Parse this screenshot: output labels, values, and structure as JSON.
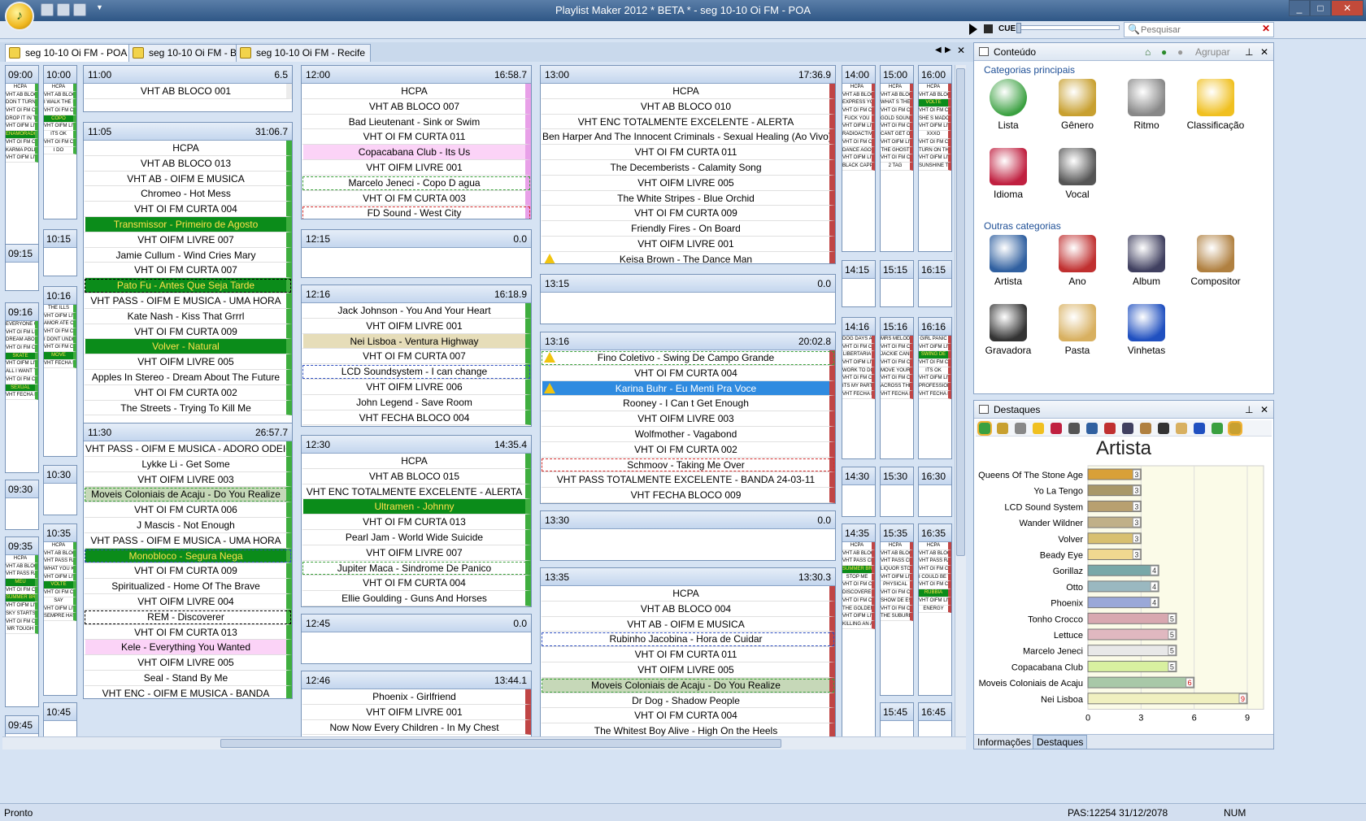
{
  "window": {
    "title": "Playlist Maker 2012 * BETA * - seg 10-10 Oi FM - POA"
  },
  "toolbar": {
    "cue": "CUE",
    "search_placeholder": "Pesquisar"
  },
  "tabs": [
    "seg 10-10 Oi FM - POA",
    "seg 10-10 Oi FM - BH",
    "seg 10-10 Oi FM - Recife"
  ],
  "blocks": {
    "b1100": {
      "time": "11:00",
      "dur": "6.5",
      "items": [
        "VHT AB BLOCO 001"
      ]
    },
    "b1105": {
      "time": "11:05",
      "dur": "31:06.7",
      "items": [
        "HCPA",
        "VHT AB BLOCO 013",
        "VHT AB - OIFM E MUSICA",
        "Chromeo - Hot Mess",
        "VHT OI FM CURTA 004",
        "Transmissor - Primeiro de Agosto",
        "VHT OIFM LIVRE 007",
        "Jamie Cullum - Wind Cries Mary",
        "VHT OI FM CURTA 007",
        "Pato Fu - Antes Que Seja Tarde",
        "VHT PASS - OIFM E MUSICA - UMA HORA",
        "Kate Nash - Kiss That Grrrl",
        "VHT OI FM CURTA 009",
        "Volver - Natural",
        "VHT OIFM LIVRE 005",
        "Apples In Stereo - Dream About The Future",
        "VHT OI FM CURTA 002",
        "The Streets - Trying To Kill Me"
      ]
    },
    "b1130": {
      "time": "11:30",
      "dur": "26:57.7",
      "items": [
        "VHT PASS - OIFM E MUSICA - ADORO ODEIO",
        "Lykke Li - Get Some",
        "VHT OIFM LIVRE 003",
        "Moveis Coloniais de Acaju - Do You Realize",
        "VHT OI FM CURTA 006",
        "J Mascis - Not Enough",
        "VHT PASS - OIFM E MUSICA - UMA HORA",
        "Monobloco - Segura Nega",
        "VHT OI FM CURTA 009",
        "Spiritualized - Home Of The Brave",
        "VHT OIFM LIVRE 004",
        "REM - Discoverer",
        "VHT OI FM CURTA 013",
        "Kele - Everything You Wanted",
        "VHT OIFM LIVRE 005",
        "Seal - Stand By Me",
        "VHT ENC - OIFM E MUSICA - BANDA"
      ]
    },
    "b1200": {
      "time": "12:00",
      "dur": "16:58.7",
      "items": [
        "HCPA",
        "VHT AB BLOCO 007",
        "Bad Lieutenant - Sink or Swim",
        "VHT OI FM CURTA 011",
        "Copacabana Club - Its Us",
        "VHT OIFM LIVRE 001",
        "Marcelo Jeneci - Copo D agua",
        "VHT OI FM CURTA 003",
        "FD Sound - West City"
      ]
    },
    "b1215": {
      "time": "12:15",
      "dur": "0.0",
      "items": []
    },
    "b1216": {
      "time": "12:16",
      "dur": "16:18.9",
      "items": [
        "Jack Johnson - You And Your Heart",
        "VHT OIFM LIVRE 001",
        "Nei Lisboa - Ventura Highway",
        "VHT OI FM CURTA 007",
        "LCD Soundsystem - I can change",
        "VHT OIFM LIVRE 006",
        "John Legend - Save Room",
        "VHT FECHA BLOCO 004"
      ]
    },
    "b1230": {
      "time": "12:30",
      "dur": "14:35.4",
      "items": [
        "HCPA",
        "VHT AB BLOCO 015",
        "VHT ENC TOTALMENTE EXCELENTE - ALERTA",
        "Ultramen - Johnny",
        "VHT OI FM CURTA 013",
        "Pearl Jam - World Wide Suicide",
        "VHT OIFM LIVRE 007",
        "Jupiter Maca - Sindrome De Panico",
        "VHT OI FM CURTA 004",
        "Ellie Goulding - Guns And Horses"
      ]
    },
    "b1245": {
      "time": "12:45",
      "dur": "0.0",
      "items": []
    },
    "b1246": {
      "time": "12:46",
      "dur": "13:44.1",
      "items": [
        "Phoenix - Girlfriend",
        "VHT OIFM LIVRE 001",
        "Now Now Every Children - In My Chest"
      ]
    },
    "b1300": {
      "time": "13:00",
      "dur": "17:36.9",
      "items": [
        "HCPA",
        "VHT AB BLOCO 010",
        "VHT ENC TOTALMENTE EXCELENTE - ALERTA",
        "Ben Harper And The Innocent Criminals - Sexual Healing (Ao Vivo)",
        "VHT OI FM CURTA 011",
        "The Decemberists - Calamity Song",
        "VHT OIFM LIVRE 005",
        "The White Stripes - Blue Orchid",
        "VHT OI FM CURTA 009",
        "Friendly Fires -  On Board",
        "VHT OIFM LIVRE 001",
        "Keisa Brown - The Dance Man"
      ]
    },
    "b1315": {
      "time": "13:15",
      "dur": "0.0",
      "items": []
    },
    "b1316": {
      "time": "13:16",
      "dur": "20:02.8",
      "items": [
        "Fino Coletivo - Swing De Campo Grande",
        "VHT OI FM CURTA 004",
        "Karina Buhr - Eu Menti Pra Voce",
        "Rooney - I Can t Get Enough",
        "VHT OIFM LIVRE 003",
        "Wolfmother - Vagabond",
        "VHT OI FM CURTA 002",
        "Schmoov - Taking Me Over",
        "VHT PASS TOTALMENTE EXCELENTE - BANDA 24-03-11",
        "VHT FECHA BLOCO 009"
      ]
    },
    "b1330": {
      "time": "13:30",
      "dur": "0.0",
      "items": []
    },
    "b1335": {
      "time": "13:35",
      "dur": "13:30.3",
      "items": [
        "HCPA",
        "VHT AB BLOCO 004",
        "VHT AB - OIFM E MUSICA",
        "Rubinho Jacobina - Hora de Cuidar",
        "VHT OI FM CURTA 011",
        "VHT OIFM LIVRE 005",
        "Moveis Coloniais de Acaju - Do You Realize",
        "Dr Dog - Shadow People",
        "VHT OI FM CURTA 004",
        "The Whitest Boy Alive - High On the Heels"
      ]
    }
  },
  "mini": {
    "c0900": {
      "time": "09:00",
      "items": [
        "HCPA",
        "VHT AB BLOCO 016",
        "DON T TURN AROUND",
        "VHT OI FM CURTA 013",
        "DROP IT IN THE SLOT",
        "VHT OIFM LIVRE 006",
        "ENAMORADO",
        "VHT OI FM CURTA 002",
        "KARMA POLICE",
        "VHT OIFM LIVRE 003"
      ]
    },
    "c0915": {
      "time": "09:15",
      "items": []
    },
    "c0916": {
      "time": "09:16",
      "items": [
        "EVERYONE GETS A STAR",
        "VHT OI FM LIVRE 003",
        "DREAM ABOUT THE",
        "VHT OI FM CURTA 009",
        "SKATE",
        "VHT OIFM LIVRE 006",
        "ALL I WANT TO DO",
        "VHT OI FM CURTA 005",
        "SEXUAL",
        "VHT FECHA BLOCO 007"
      ]
    },
    "c0930": {
      "time": "09:30",
      "items": []
    },
    "c0935": {
      "time": "09:35",
      "items": [
        "HCPA",
        "VHT AB BLOCO 003",
        "VHT PASS RADIO CAFE",
        "MEU",
        "VHT OI FM CURTA 011",
        "SUMMER BREEZE",
        "VHT OIFM LIVRE 001",
        "SKY STARTS FALLING",
        "VHT OI FM CURTA 002",
        "MR TOUGH"
      ]
    },
    "c0945": {
      "time": "09:45",
      "items": []
    },
    "c1000": {
      "time": "10:00",
      "items": [
        "HCPA",
        "VHT AB BLOCO 002",
        "I WALK THE LINE",
        "VHT OI FM CURTA 005",
        "COPO",
        "VHT OIFM LIVRE 001",
        "ITS OK",
        "VHT OI FM CURTA 004",
        "I DO"
      ]
    },
    "c1015": {
      "time": "10:15",
      "items": []
    },
    "c1016": {
      "time": "10:16",
      "items": [
        "THE ILLS",
        "VHT OIFM LIVRE 007",
        "AMOR ATE O FIM",
        "VHT OI FM CURTA 003",
        "I DONT UNDERSTAND",
        "VHT OI FM CURTA 006",
        "MOVE",
        "VHT FECHA BLOCO 001"
      ]
    },
    "c1030": {
      "time": "10:30",
      "items": []
    },
    "c1035": {
      "time": "10:35",
      "items": [
        "HCPA",
        "VHT AB BLOCO 016",
        "VHT PASS RADIO CAFE",
        "WHAT YOU KNOW",
        "VHT OIFM LIVRE 005",
        "VOLTE",
        "VHT OI FM CURTA 004",
        "SAY",
        "VHT OIFM LIVRE 007",
        "SEMPRE HAY ESPERANZA"
      ]
    },
    "c1045": {
      "time": "10:45",
      "items": []
    },
    "c1400": {
      "time": "14:00",
      "items": [
        "HCPA",
        "VHT AB BLOCO 004",
        "EXPRESS YOURSELF",
        "VHT OI FM CURTA 009",
        "FUCK YOU",
        "VHT OIFM LIVRE 001",
        "RADIOACTIVE",
        "VHT OI FM CURTA 011",
        "DANCE AGORA",
        "VHT OIFM LIVRE 004",
        "BLACK CAPPUCCINO"
      ]
    },
    "c1415": {
      "time": "14:15",
      "items": []
    },
    "c1416": {
      "time": "14:16",
      "items": [
        "DOG DAYS ARE OVER",
        "VHT OI FM CURTA 009",
        "LIBERTARIA",
        "VHT OIFM LIVRE 002",
        "WORK TO DO",
        "VHT OI FM CURTA 004",
        "ITS MY PARTY",
        "VHT FECHA BLOCO 008"
      ]
    },
    "c1430": {
      "time": "14:30",
      "items": []
    },
    "c1435": {
      "time": "14:35",
      "items": [
        "HCPA",
        "VHT AB BLOCO 013",
        "VHT PASS CLUBE OIFM",
        "SUMMER BREEZE",
        "STOP ME",
        "VHT OI FM CURTA 003",
        "DISCOVERER",
        "VHT OI FM CURTA 006",
        "THE GOLDEN AGE",
        "VHT OIFM LIVRE 001",
        "KILLING AN ARAB"
      ]
    },
    "c1500": {
      "time": "15:00",
      "items": [
        "HCPA",
        "VHT AB BLOCO 015",
        "WHAT S THE COST",
        "VHT OI FM CURTA 009",
        "GOLD SOUNDZ",
        "VHT OI FM CURTA 011",
        "CANT GET OVER YOU",
        "VHT OIFM LIVRE 003",
        "THE GHOST",
        "VHT OI FM CURTA 009",
        "2 TAG"
      ]
    },
    "c1515": {
      "time": "15:15",
      "items": []
    },
    "c1516": {
      "time": "15:16",
      "items": [
        "MRS MELODY",
        "VHT OI FM CURTA 009",
        "JACKIE CANE",
        "VHT OI FM CURTA 006",
        "MOVE YOUR FEET",
        "VHT OI FM CURTA 003",
        "ACROSS THE UNIVERSE",
        "VHT FECHA BLOCO 005"
      ]
    },
    "c1530": {
      "time": "15:30",
      "items": []
    },
    "c1535": {
      "time": "15:35",
      "items": [
        "HCPA",
        "VHT AB BLOCO 014",
        "VHT PASS CLUBE OIFM",
        "LIQUOR STORE BLUES",
        "VHT OIFM LIVRE 001",
        "PHYSICAL",
        "VHT OI FM CURTA 004",
        "SHOW DE ESTRELAS",
        "VHT OI FM CURTA 002",
        "THE SUBURBS"
      ]
    },
    "c1545": {
      "time": "15:45",
      "items": []
    },
    "c1600": {
      "time": "16:00",
      "items": [
        "HCPA",
        "VHT AB BLOCO 010",
        "VOLTE",
        "VHT OI FM CURTA 013",
        "SHE S MADONNA",
        "VHT OIFM LIVRE 006",
        "XXXO",
        "VHT OI FM CURTA 006",
        "TURN ON THE SCREW",
        "VHT OIFM LIVRE 006",
        "SUNSHINE TODAY"
      ]
    },
    "c1615": {
      "time": "16:15",
      "items": []
    },
    "c1616": {
      "time": "16:16",
      "items": [
        "GIRL PANIC",
        "VHT OIFM LIVRE 003",
        "SWING DE",
        "VHT OI FM CURTA 008",
        "ITS OK",
        "VHT OIFM LIVRE 004",
        "PROFESSIONAL SUICIDE",
        "VHT FECHA BLOCO 004"
      ]
    },
    "c1630": {
      "time": "16:30",
      "items": []
    },
    "c1635": {
      "time": "16:35",
      "items": [
        "HCPA",
        "VHT AB BLOCO 011",
        "VHT PASS RADIO CAFE",
        "VHT OI FM CURTA 004",
        "I COULD BE WRONG",
        "VHT OI FM CURTA 003",
        "RUBBIA",
        "VHT OIFM LIVRE 003",
        "ENERGY"
      ]
    },
    "c1645": {
      "time": "16:45",
      "items": []
    }
  },
  "conteudo": {
    "title": "Conteúdo",
    "agrupar": "Agrupar",
    "principais_label": "Categorias principais",
    "principais": [
      "Lista",
      "Gênero",
      "Ritmo",
      "Classificação",
      "Idioma",
      "Vocal"
    ],
    "outras_label": "Outras categorias",
    "outras": [
      "Artista",
      "Ano",
      "Album",
      "Compositor",
      "Gravadora",
      "Pasta",
      "Vinhetas"
    ]
  },
  "destaques": {
    "title": "Destaques",
    "bottom_tabs": [
      "Informações",
      "Destaques"
    ]
  },
  "chart_data": {
    "type": "bar",
    "orientation": "horizontal",
    "title": "Artista",
    "categories": [
      "Queens Of The Stone Age",
      "Yo La Tengo",
      "LCD Sound System",
      "Wander Wildner",
      "Volver",
      "Beady Eye",
      "Gorillaz",
      "Otto",
      "Phoenix",
      "Tonho Crocco",
      "Lettuce",
      "Marcelo Jeneci",
      "Copacabana Club",
      "Moveis Coloniais de Acaju",
      "Nei Lisboa"
    ],
    "values": [
      3,
      3,
      3,
      3,
      3,
      3,
      4,
      4,
      4,
      5,
      5,
      5,
      5,
      6,
      9
    ],
    "colors": [
      "#d8a038",
      "#a89868",
      "#b8a070",
      "#c0b088",
      "#d8c070",
      "#f0d890",
      "#78a8a8",
      "#9ab8c0",
      "#9aa8d8",
      "#d8a8b0",
      "#e0b8c0",
      "#e8e8e8",
      "#d8f0a0",
      "#a8c8a8",
      "#f0f0c0"
    ],
    "xlim": [
      0,
      9
    ],
    "xticks": [
      "0",
      "3",
      "6",
      "9"
    ],
    "grid": true
  },
  "status": {
    "left": "Pronto",
    "pas": "PAS:12254 31/12/2078",
    "num": "NUM"
  }
}
